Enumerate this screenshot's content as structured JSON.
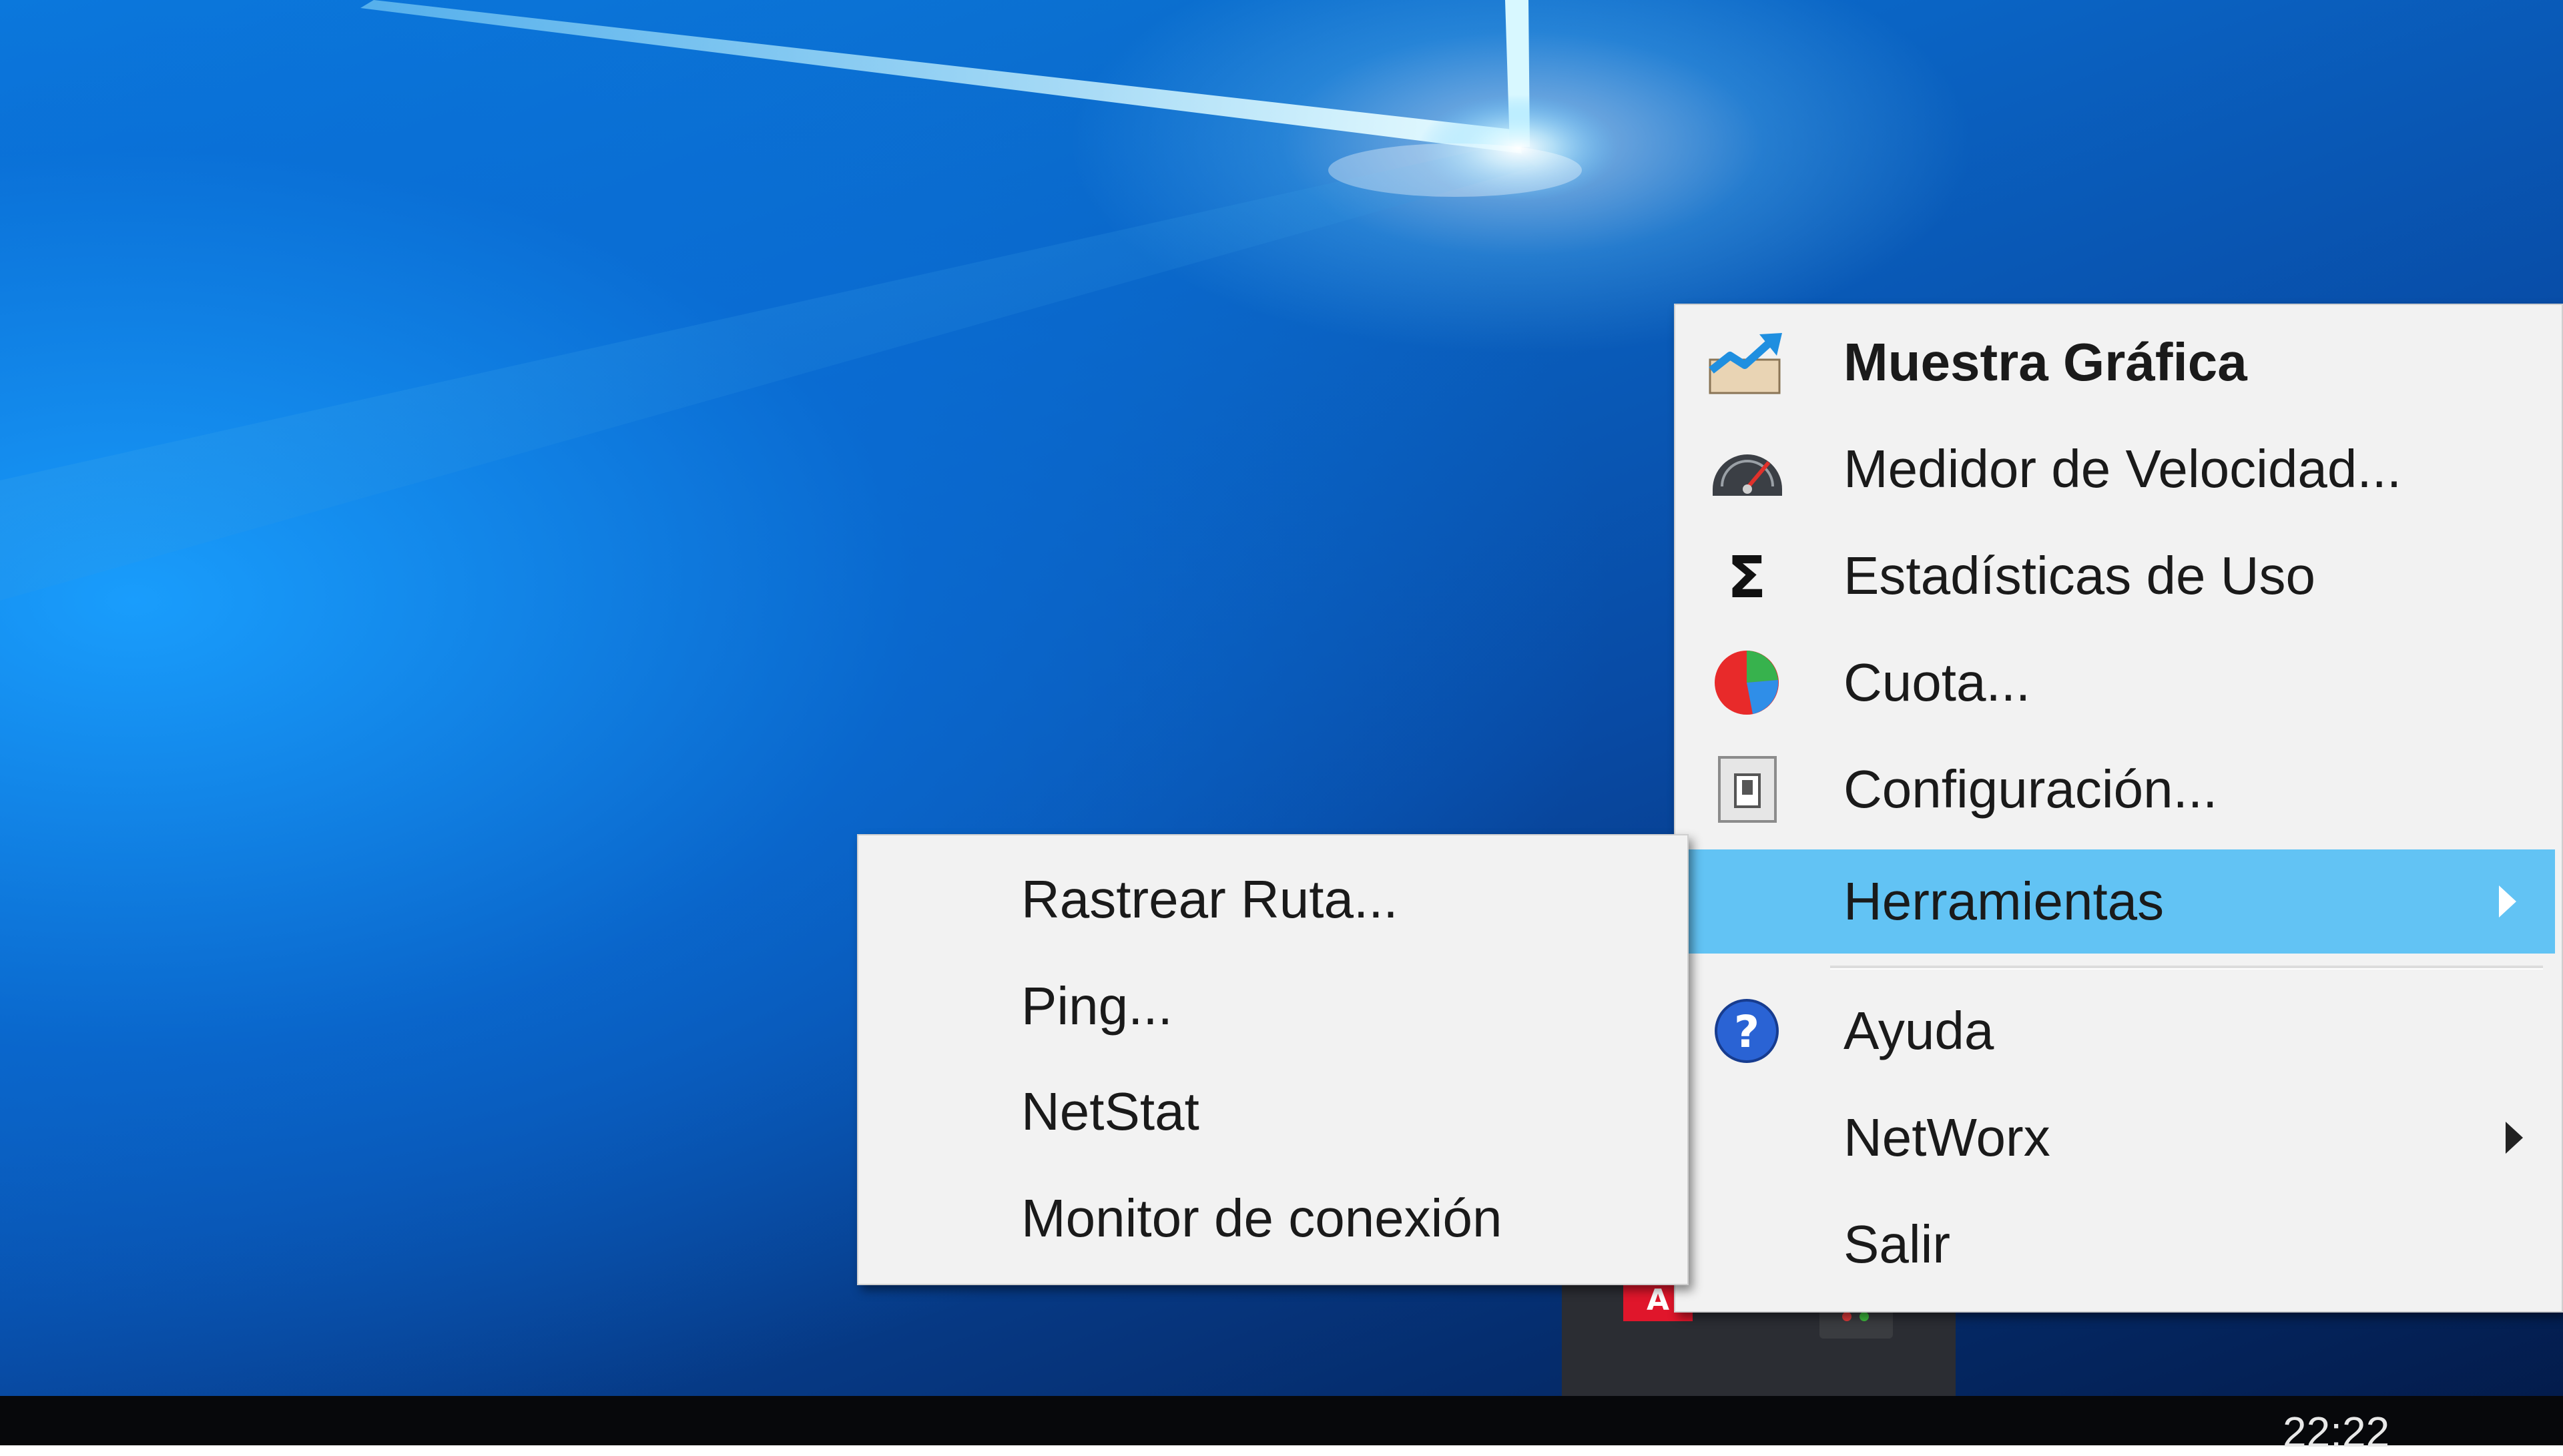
{
  "taskbar": {
    "clock": "22:22"
  },
  "main_menu": {
    "items": [
      {
        "label": "Muestra Gráfica",
        "icon": "chart-icon",
        "bold": true
      },
      {
        "label": "Medidor de Velocidad...",
        "icon": "speedometer-icon"
      },
      {
        "label": "Estadísticas de Uso",
        "icon": "sigma-icon"
      },
      {
        "label": "Cuota...",
        "icon": "pie-chart-icon"
      },
      {
        "label": "Configuración...",
        "icon": "settings-switch-icon"
      },
      {
        "label": "Herramientas",
        "submenu": true,
        "highlighted": true
      },
      {
        "label": "Ayuda",
        "icon": "help-icon"
      },
      {
        "label": "NetWorx",
        "submenu": true
      },
      {
        "label": "Salir"
      }
    ]
  },
  "sub_menu": {
    "items": [
      {
        "label": "Rastrear Ruta..."
      },
      {
        "label": "Ping..."
      },
      {
        "label": "NetStat"
      },
      {
        "label": "Monitor de conexión"
      }
    ]
  },
  "colors": {
    "menu_background": "#f2f2f2",
    "highlight": "#62c3f4",
    "taskbar": "#07080b",
    "desktop_blue": "#0a64c4"
  }
}
